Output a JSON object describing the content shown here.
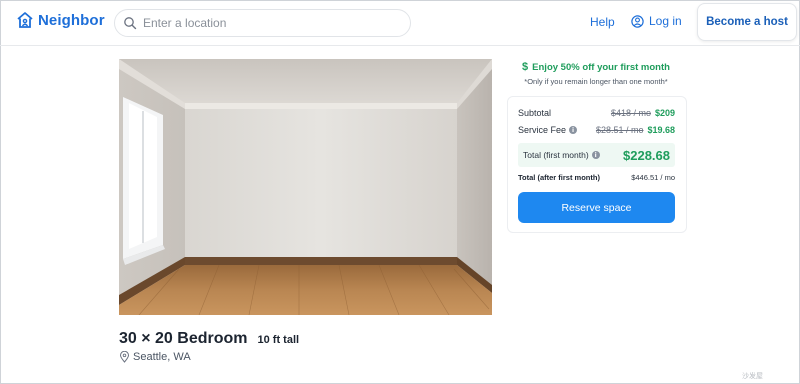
{
  "header": {
    "brand": "Neighbor",
    "search_placeholder": "Enter a location",
    "help": "Help",
    "login": "Log in",
    "host_button": "Become a host"
  },
  "icons": {
    "logo": "house-logo-icon",
    "search": "search-icon",
    "user": "user-circle-icon",
    "location": "location-pin-icon",
    "dollar": "dollar-icon",
    "info": "info-icon"
  },
  "colors": {
    "brand_blue": "#1e6fd9",
    "accent_green": "#1f9d5c",
    "button_blue": "#1e88f0"
  },
  "listing": {
    "title": "30 × 20 Bedroom",
    "height": "10 ft tall",
    "location": "Seattle, WA"
  },
  "pricing": {
    "promo": "Enjoy 50% off your first month",
    "promo_note": "*Only if you remain longer than one month*",
    "subtotal_label": "Subtotal",
    "subtotal_old": "$418 / mo",
    "subtotal_new": "$209",
    "fee_label": "Service Fee",
    "fee_old": "$28.51 / mo",
    "fee_new": "$19.68",
    "total_first_label": "Total (first month)",
    "total_first_value": "$228.68",
    "total_after_label": "Total (after first month)",
    "total_after_value": "$446.51 / mo",
    "reserve_button": "Reserve space"
  },
  "watermark": "沙发屋"
}
